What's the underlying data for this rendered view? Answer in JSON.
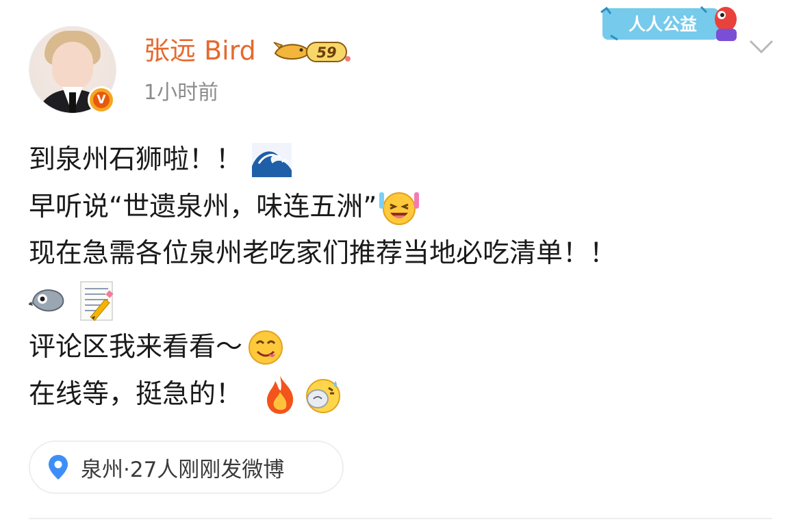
{
  "post": {
    "author": {
      "name": "张远 Bird",
      "level": "59",
      "verified_mark": "V",
      "name_color": "#e5692d"
    },
    "time": "1小时前",
    "charity_badge": "人人公益",
    "lines": [
      "到泉州石狮啦！！",
      "早听说“世遗泉州，味连五洲”",
      "现在急需各位泉州老吃家们推荐当地必吃清单！！",
      "",
      "评论区我来看看～",
      "在线等，挺急的！"
    ],
    "emojis": {
      "line1": "wave-emoji",
      "line2": "laughing-emoji",
      "line4": [
        "bird-emoji",
        "memo-emoji"
      ],
      "line5": "yum-emoji",
      "line6": [
        "fire-emoji",
        "sweat-emoji"
      ]
    },
    "location": {
      "text": "泉州·27人刚刚发微博",
      "icon": "location-pin-icon",
      "icon_color": "#3e8ef7"
    }
  }
}
